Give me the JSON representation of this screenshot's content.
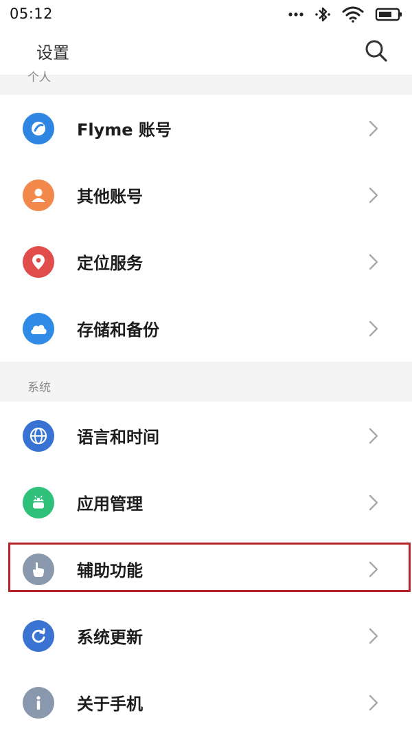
{
  "status_bar": {
    "time": "05:12",
    "icons": [
      "more-dots-icon",
      "bluetooth-icon",
      "wifi-icon",
      "battery-icon"
    ]
  },
  "header": {
    "title": "设置",
    "search_icon": "search-icon"
  },
  "sections": [
    {
      "label": "个人",
      "items": [
        {
          "label": "Flyme 账号",
          "icon": "flyme-account-icon",
          "color": "#2f86e2"
        },
        {
          "label": "其他账号",
          "icon": "user-icon",
          "color": "#f2894a"
        },
        {
          "label": "定位服务",
          "icon": "location-pin-icon",
          "color": "#e14d4a"
        },
        {
          "label": "存储和备份",
          "icon": "cloud-icon",
          "color": "#2f8be6"
        }
      ]
    },
    {
      "label": "系统",
      "items": [
        {
          "label": "语言和时间",
          "icon": "globe-icon",
          "color": "#3873d4"
        },
        {
          "label": "应用管理",
          "icon": "android-icon",
          "color": "#2fc07a"
        },
        {
          "label": "辅助功能",
          "icon": "hand-pointer-icon",
          "color": "#8a98ad",
          "highlighted": true
        },
        {
          "label": "系统更新",
          "icon": "refresh-icon",
          "color": "#3a73d2"
        },
        {
          "label": "关于手机",
          "icon": "info-icon",
          "color": "#8a98ad"
        }
      ]
    }
  ],
  "colors": {
    "highlight_border": "#b4252a",
    "section_background": "#f4f4f4",
    "chevron": "#a8a8a8"
  }
}
